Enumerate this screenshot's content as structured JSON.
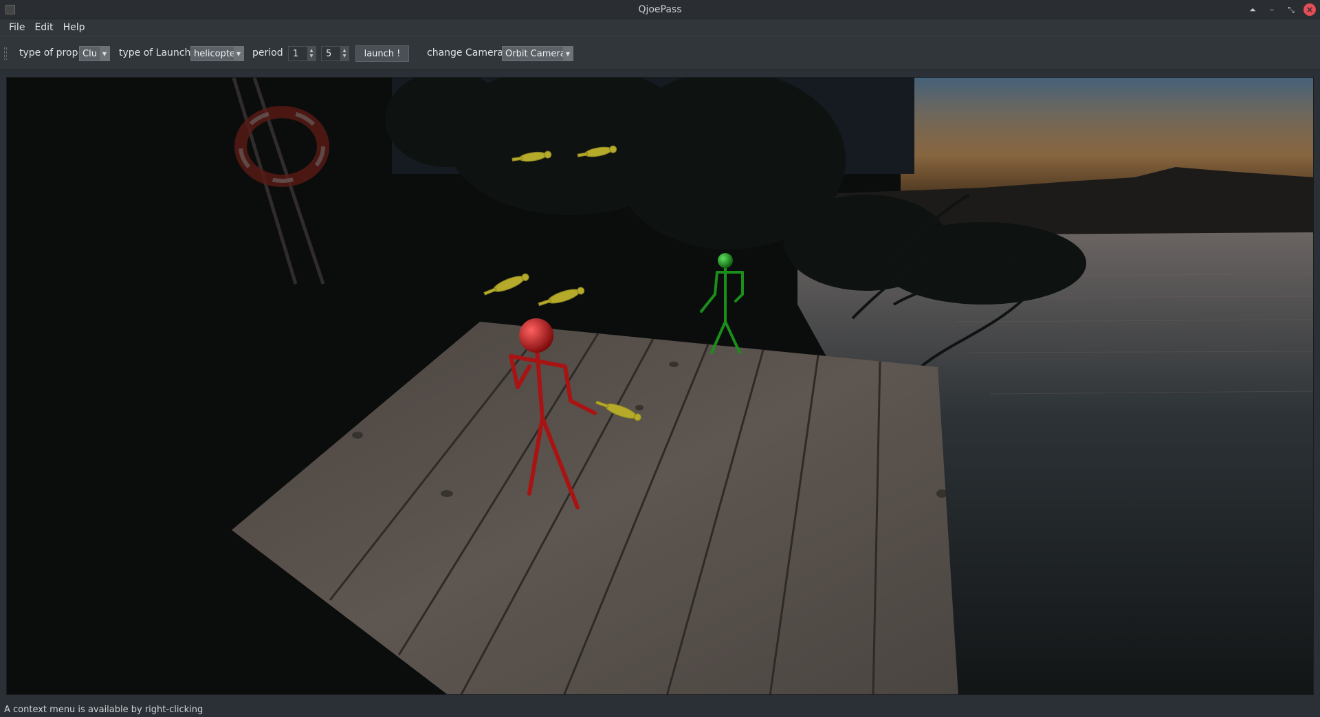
{
  "window": {
    "title": "QjoePass"
  },
  "menubar": {
    "items": [
      "File",
      "Edit",
      "Help"
    ]
  },
  "toolbar": {
    "prop_label": "type of prop",
    "prop_value": "Clu",
    "launch_label": "type of Launch",
    "launch_value": "helicopte",
    "period_label": "period",
    "period_value1": "1",
    "period_value2": "5",
    "launch_button": "launch !",
    "camera_label": "change Camera",
    "camera_value": "Orbit Camera"
  },
  "scene": {
    "jugglers": [
      {
        "name": "red-juggler",
        "color": "#b01515"
      },
      {
        "name": "green-juggler",
        "color": "#1a8f1a"
      }
    ],
    "prop_color": "#b5aa2a"
  },
  "status": {
    "message": "A context menu is available by right-clicking"
  }
}
